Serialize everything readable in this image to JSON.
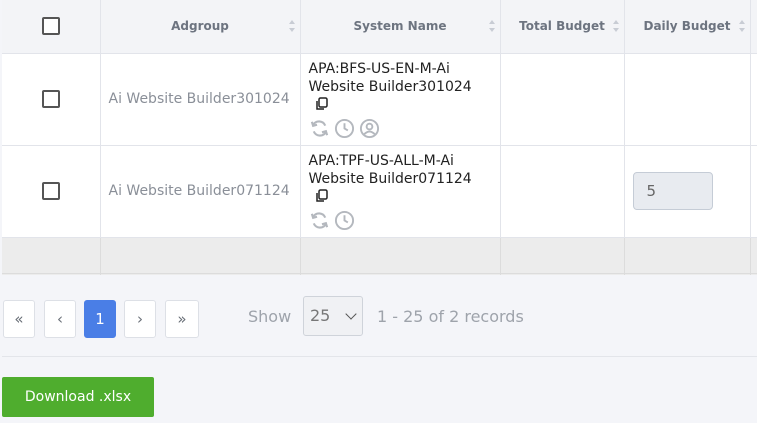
{
  "table": {
    "columns": [
      "",
      "Adgroup",
      "System Name",
      "Total Budget",
      "Daily Budget"
    ],
    "rows": [
      {
        "adgroup": "Ai Website Builder301024",
        "system_name_line1": "APA:BFS-US-EN-M-Ai",
        "system_name_line2": "Website Builder301024",
        "total_budget": "",
        "daily_budget": ""
      },
      {
        "adgroup": "Ai Website Builder071124",
        "system_name_line1": "APA:TPF-US-ALL-M-Ai",
        "system_name_line2": "Website Builder071124",
        "total_budget": "",
        "daily_budget": "5"
      }
    ]
  },
  "pagination": {
    "first": "«",
    "prev": "‹",
    "current": "1",
    "next": "›",
    "last": "»",
    "show_label": "Show",
    "per_page": "25",
    "records_text": "1 - 25 of 2  records"
  },
  "download_label": "Download .xlsx",
  "colors": {
    "primary": "#4a7ee6",
    "download": "#4fad2e"
  }
}
